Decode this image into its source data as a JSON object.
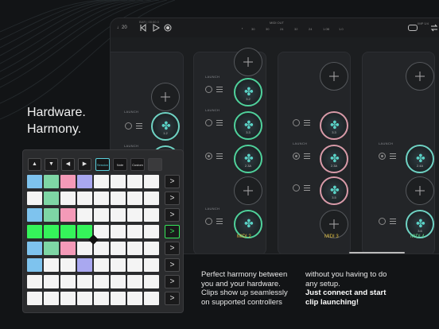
{
  "headline": [
    "Hardware.",
    "Harmony."
  ],
  "caption_left": "Perfect harmony between you and your hardware. Clips show up seamlessly on supported controllers",
  "caption_right": "without you having to do any setup.",
  "caption_right_bold": "Just connect and start clip launching!",
  "tablet": {
    "tempo": "♩20",
    "top_small": "BAR | 00:00.0",
    "midi_out": "MIDI OUT",
    "ruler": [
      "30",
      "30",
      "24",
      "32",
      "24",
      "1.0B",
      "1.0"
    ],
    "right_small": "IMP 1/4",
    "columns": [
      {
        "title": "MIDI 2",
        "launch_label": "LAUNCH",
        "clip_nums": [
          "3.2",
          "3.3",
          "2.3A"
        ],
        "style": "g"
      },
      {
        "title": "MIDI 3",
        "launch_label": "LAUNCH",
        "clip_nums": [
          "3.3",
          "2.3A",
          "3.5"
        ],
        "style": "p"
      },
      {
        "title": "MIDI 4",
        "launch_label": "LAUNCH",
        "clip_nums": [
          "2.4A",
          "3.6"
        ],
        "style": "t"
      }
    ],
    "first_col": {
      "launch_label": "LAUNCH",
      "clip_nums": [
        "1.2",
        "2.1A"
      ]
    }
  },
  "controller": {
    "arrows": [
      "▲",
      "▼",
      "◀",
      "▶"
    ],
    "modes": [
      "Session",
      "Note",
      "Custom",
      ""
    ],
    "side_buttons": [
      ">",
      ">",
      ">",
      ">",
      ">",
      ">",
      ">",
      ">"
    ],
    "active_side": 3,
    "colors": {
      "blue": "#7ec3ee",
      "green": "#7ed6a5",
      "pink": "#f49ab8",
      "purple": "#a9a8f0",
      "bright_green": "#35f45a"
    }
  }
}
